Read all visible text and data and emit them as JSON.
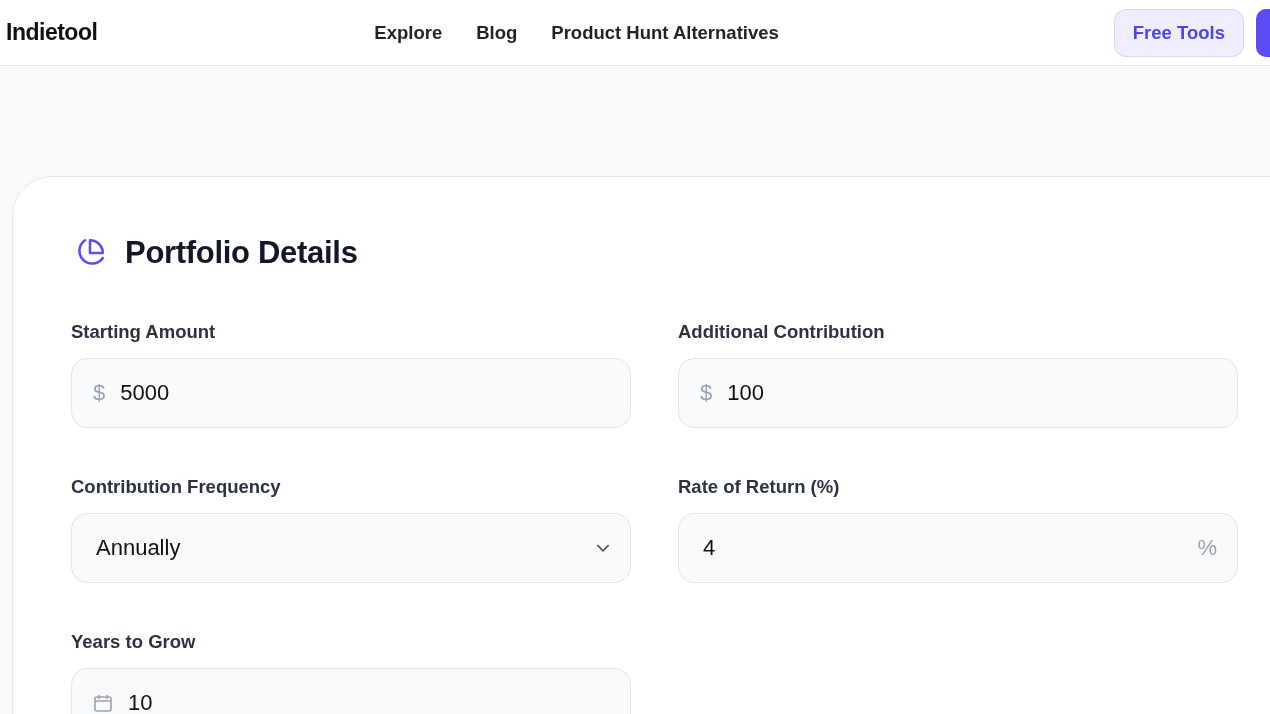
{
  "header": {
    "logo": "Indietool",
    "nav": [
      "Explore",
      "Blog",
      "Product Hunt Alternatives"
    ],
    "free_tools_button": "Free Tools"
  },
  "card": {
    "title": "Portfolio Details",
    "fields": [
      {
        "kind": "prefix",
        "label": "Starting Amount",
        "prefix": "$",
        "value": "5000"
      },
      {
        "kind": "prefix",
        "label": "Additional Contribution",
        "prefix": "$",
        "value": "100"
      },
      {
        "kind": "select",
        "label": "Contribution Frequency",
        "value": "Annually"
      },
      {
        "kind": "suffix",
        "label": "Rate of Return (%)",
        "suffix": "%",
        "value": "4"
      },
      {
        "kind": "calendar",
        "label": "Years to Grow",
        "value": "10"
      }
    ]
  }
}
